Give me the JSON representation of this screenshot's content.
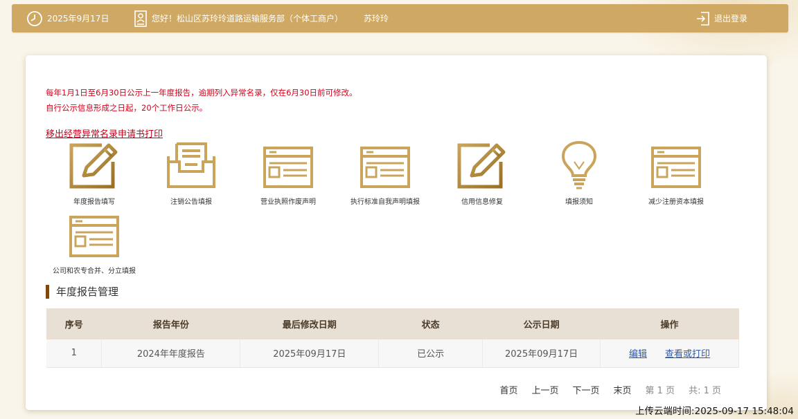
{
  "header": {
    "date": "2025年9月17日",
    "greeting": "您好！松山区苏玲玲道路运输服务部（个体工商户）",
    "username": "苏玲玲",
    "logout_label": "退出登录"
  },
  "notices": {
    "line1": "每年1月1日至6月30日公示上一年度报告，逾期列入异常名录，仅在6月30日前可修改。",
    "line2": "自行公示信息形成之日起，20个工作日公示。",
    "link": "移出经营异常名录申请书打印"
  },
  "tiles": [
    {
      "label": "年度报告填写",
      "icon": "edit-icon"
    },
    {
      "label": "注销公告填报",
      "icon": "inbox-icon"
    },
    {
      "label": "营业执照作废声明",
      "icon": "form-icon"
    },
    {
      "label": "执行标准自我声明填报",
      "icon": "form-icon"
    },
    {
      "label": "信用信息修复",
      "icon": "edit-icon"
    },
    {
      "label": "填报须知",
      "icon": "lightbulb-icon"
    },
    {
      "label": "减少注册资本填报",
      "icon": "form-icon"
    },
    {
      "label": "公司和农专合并、分立填报",
      "icon": "form-icon"
    }
  ],
  "section_title": "年度报告管理",
  "table": {
    "headers": [
      "序号",
      "报告年份",
      "最后修改日期",
      "状态",
      "公示日期",
      "操作"
    ],
    "rows": [
      {
        "index": "1",
        "year": "2024年年度报告",
        "modified": "2025年09月17日",
        "status": "已公示",
        "published": "2025年09月17日",
        "edit": "编辑",
        "view": "查看或打印"
      }
    ]
  },
  "pager": {
    "first": "首页",
    "prev": "上一页",
    "next": "下一页",
    "last": "末页",
    "current": "第 1 页",
    "total": "共:  1 页"
  },
  "upload_time": "上传云端时间:2025-09-17 15:48:04",
  "colors": {
    "topbar": "#cfa863",
    "icon_gold": "#c9a45a",
    "icon_dark": "#a8802f",
    "notice_red": "#d0021b",
    "link_blue": "#2e5aa8"
  }
}
